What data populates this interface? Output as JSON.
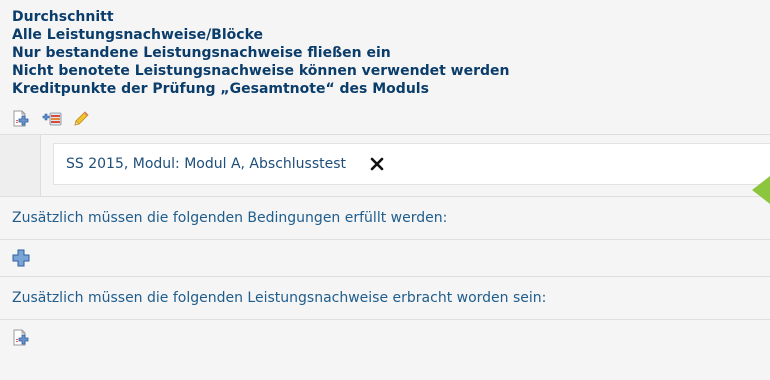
{
  "header": {
    "lines": [
      "Durchschnitt",
      "Alle Leistungsnachweise/Blöcke",
      "Nur bestandene Leistungsnachweise fließen ein",
      "Nicht benotete Leistungsnachweise können verwendet werden",
      "Kreditpunkte der Prüfung „Gesamtnote“ des Moduls"
    ]
  },
  "toolbar": {
    "icons": [
      "add-document-icon",
      "add-list-icon",
      "edit-pencil-icon"
    ]
  },
  "selected_item": {
    "label": "SS 2015, Modul: Modul A, Abschlusstest",
    "remove_icon": "close-icon",
    "indicator_color": "#8cc63f"
  },
  "conditions": {
    "text": "Zusätzlich müssen die folgenden Bedingungen erfüllt werden:",
    "add_icon": "add-plus-icon"
  },
  "requirements": {
    "text": "Zusätzlich müssen die folgenden Leistungsnachweise erbracht worden sein:",
    "add_icon": "add-document-icon"
  }
}
